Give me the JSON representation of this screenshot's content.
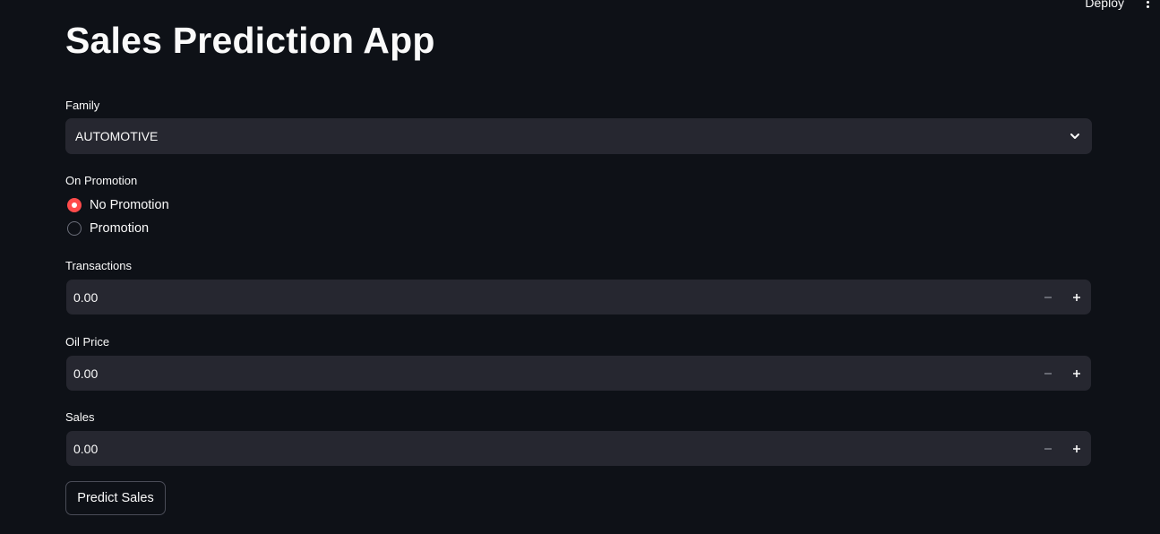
{
  "header": {
    "deploy_label": "Deploy"
  },
  "app": {
    "title": "Sales Prediction App"
  },
  "family": {
    "label": "Family",
    "selected": "AUTOMOTIVE"
  },
  "promotion": {
    "label": "On Promotion",
    "options": [
      {
        "label": "No Promotion",
        "selected": true
      },
      {
        "label": "Promotion",
        "selected": false
      }
    ]
  },
  "transactions": {
    "label": "Transactions",
    "value": "0.00"
  },
  "oil_price": {
    "label": "Oil Price",
    "value": "0.00"
  },
  "sales": {
    "label": "Sales",
    "value": "0.00"
  },
  "predict": {
    "label": "Predict Sales"
  },
  "colors": {
    "background": "#0e1117",
    "input_bg": "#262730",
    "accent": "#ff4b4b",
    "text": "#fafafa"
  }
}
